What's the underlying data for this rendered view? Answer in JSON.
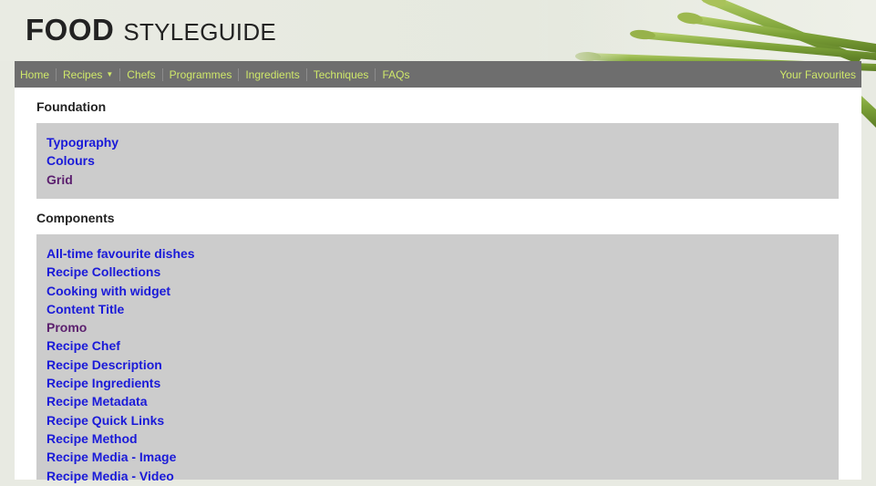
{
  "header": {
    "logo_bold": "FOOD",
    "logo_light": "STYLEGUIDE"
  },
  "nav": {
    "items": [
      {
        "label": "Home"
      },
      {
        "label": "Recipes",
        "has_dropdown": true
      },
      {
        "label": "Chefs"
      },
      {
        "label": "Programmes"
      },
      {
        "label": "Ingredients"
      },
      {
        "label": "Techniques"
      },
      {
        "label": "FAQs"
      }
    ],
    "right_label": "Your Favourites"
  },
  "sections": [
    {
      "title": "Foundation",
      "links": [
        {
          "label": "Typography",
          "visited": false
        },
        {
          "label": "Colours",
          "visited": false
        },
        {
          "label": "Grid",
          "visited": true
        }
      ]
    },
    {
      "title": "Components",
      "links": [
        {
          "label": "All-time favourite dishes",
          "visited": false
        },
        {
          "label": "Recipe Collections",
          "visited": false
        },
        {
          "label": "Cooking with widget",
          "visited": false
        },
        {
          "label": "Content Title",
          "visited": false
        },
        {
          "label": "Promo",
          "visited": true
        },
        {
          "label": "Recipe Chef",
          "visited": false
        },
        {
          "label": "Recipe Description",
          "visited": false
        },
        {
          "label": "Recipe Ingredients",
          "visited": false
        },
        {
          "label": "Recipe Metadata",
          "visited": false
        },
        {
          "label": "Recipe Quick Links",
          "visited": false
        },
        {
          "label": "Recipe Method",
          "visited": false
        },
        {
          "label": "Recipe Media - Image",
          "visited": false
        },
        {
          "label": "Recipe Media - Video",
          "visited": false
        }
      ]
    }
  ],
  "colors": {
    "nav_bg": "#6e6e6e",
    "nav_text": "#cfe86a",
    "link": "#1a1ad8",
    "link_visited": "#5b1f6e",
    "panel_bg": "#cccccc"
  }
}
